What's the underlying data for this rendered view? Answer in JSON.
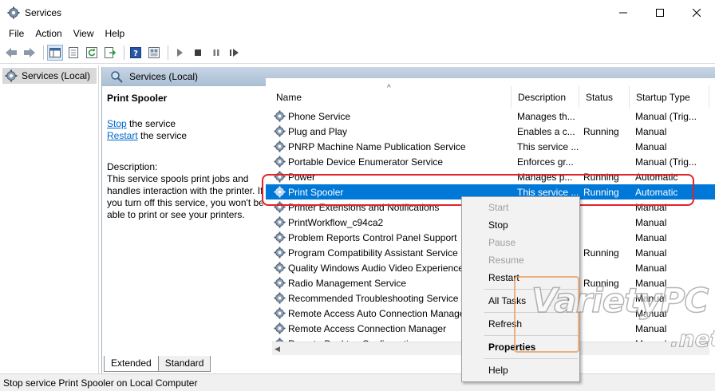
{
  "window": {
    "title": "Services",
    "app_icon": "gear-icon",
    "controls": [
      "minimize-icon",
      "maximize-icon",
      "close-icon"
    ]
  },
  "menubar": {
    "items": [
      "File",
      "Action",
      "View",
      "Help"
    ]
  },
  "toolbar": {
    "buttons": [
      "back-icon",
      "forward-icon",
      "show-hide-tree-icon",
      "properties-icon",
      "refresh-icon",
      "export-icon",
      "help-icon",
      "console-view-icon",
      "start-service-icon",
      "stop-service-icon",
      "pause-service-icon",
      "restart-service-icon"
    ]
  },
  "tree": {
    "selected_item": "Services (Local)"
  },
  "main": {
    "header": "Services (Local)",
    "details": {
      "service_name": "Print Spooler",
      "stop_link": "Stop",
      "stop_suffix": " the service",
      "restart_link": "Restart",
      "restart_suffix": " the service",
      "description_label": "Description:",
      "description_text": "This service spools print jobs and handles interaction with the printer. If you turn off this service, you won't be able to print or see your printers."
    },
    "columns": [
      "Name",
      "Description",
      "Status",
      "Startup Type"
    ],
    "rows": [
      {
        "name": "Phone Service",
        "desc": "Manages th...",
        "status": "",
        "startup": "Manual (Trig..."
      },
      {
        "name": "Plug and Play",
        "desc": "Enables a c...",
        "status": "Running",
        "startup": "Manual"
      },
      {
        "name": "PNRP Machine Name Publication Service",
        "desc": "This service ...",
        "status": "",
        "startup": "Manual"
      },
      {
        "name": "Portable Device Enumerator Service",
        "desc": "Enforces gr...",
        "status": "",
        "startup": "Manual (Trig..."
      },
      {
        "name": "Power",
        "desc": "Manages p...",
        "status": "Running",
        "startup": "Automatic"
      },
      {
        "name": "Print Spooler",
        "desc": "This service ...",
        "status": "Running",
        "startup": "Automatic",
        "selected": true
      },
      {
        "name": "Printer Extensions and Notifications",
        "desc": "",
        "status": "",
        "startup": "Manual"
      },
      {
        "name": "PrintWorkflow_c94ca2",
        "desc": "",
        "status": "",
        "startup": "Manual"
      },
      {
        "name": "Problem Reports Control Panel Support",
        "desc": "",
        "status": "",
        "startup": "Manual"
      },
      {
        "name": "Program Compatibility Assistant Service",
        "desc": "",
        "status": "Running",
        "startup": "Manual"
      },
      {
        "name": "Quality Windows Audio Video Experience",
        "desc": "",
        "status": "",
        "startup": "Manual"
      },
      {
        "name": "Radio Management Service",
        "desc": "",
        "status": "Running",
        "startup": "Manual"
      },
      {
        "name": "Recommended Troubleshooting Service",
        "desc": "",
        "status": "",
        "startup": "Manual"
      },
      {
        "name": "Remote Access Auto Connection Manager",
        "desc": "",
        "status": "",
        "startup": "Manual"
      },
      {
        "name": "Remote Access Connection Manager",
        "desc": "",
        "status": "",
        "startup": "Manual"
      },
      {
        "name": "Remote Desktop Configuration",
        "desc": "",
        "status": "",
        "startup": "Manual"
      }
    ]
  },
  "tabs": [
    "Extended",
    "Standard"
  ],
  "status_bar": "Stop service Print Spooler on Local Computer",
  "context_menu": {
    "start": "Start",
    "stop": "Stop",
    "pause": "Pause",
    "resume": "Resume",
    "restart": "Restart",
    "all_tasks": "All Tasks",
    "refresh": "Refresh",
    "properties": "Properties",
    "help": "Help"
  },
  "watermark": {
    "brand": "VarietyPC",
    "suffix": ".net"
  },
  "colors": {
    "selection": "#0078d7",
    "highlight_ring": "#e2242a",
    "link": "#0066cc"
  }
}
